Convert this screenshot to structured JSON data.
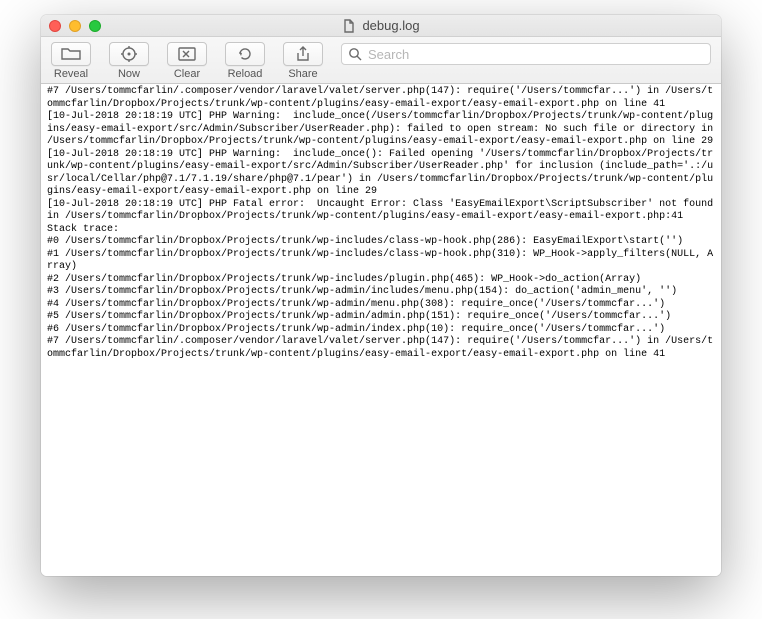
{
  "title": "debug.log",
  "toolbar": {
    "reveal": "Reveal",
    "now": "Now",
    "clear": "Clear",
    "reload": "Reload",
    "share": "Share"
  },
  "search": {
    "placeholder": "Search"
  },
  "log": "#7 /Users/tommcfarlin/.composer/vendor/laravel/valet/server.php(147): require('/Users/tommcfar...') in /Users/tommcfarlin/Dropbox/Projects/trunk/wp-content/plugins/easy-email-export/easy-email-export.php on line 41\n[10-Jul-2018 20:18:19 UTC] PHP Warning:  include_once(/Users/tommcfarlin/Dropbox/Projects/trunk/wp-content/plugins/easy-email-export/src/Admin/Subscriber/UserReader.php): failed to open stream: No such file or directory in /Users/tommcfarlin/Dropbox/Projects/trunk/wp-content/plugins/easy-email-export/easy-email-export.php on line 29\n[10-Jul-2018 20:18:19 UTC] PHP Warning:  include_once(): Failed opening '/Users/tommcfarlin/Dropbox/Projects/trunk/wp-content/plugins/easy-email-export/src/Admin/Subscriber/UserReader.php' for inclusion (include_path='.:/usr/local/Cellar/php@7.1/7.1.19/share/php@7.1/pear') in /Users/tommcfarlin/Dropbox/Projects/trunk/wp-content/plugins/easy-email-export/easy-email-export.php on line 29\n[10-Jul-2018 20:18:19 UTC] PHP Fatal error:  Uncaught Error: Class 'EasyEmailExport\\ScriptSubscriber' not found in /Users/tommcfarlin/Dropbox/Projects/trunk/wp-content/plugins/easy-email-export/easy-email-export.php:41\nStack trace:\n#0 /Users/tommcfarlin/Dropbox/Projects/trunk/wp-includes/class-wp-hook.php(286): EasyEmailExport\\start('')\n#1 /Users/tommcfarlin/Dropbox/Projects/trunk/wp-includes/class-wp-hook.php(310): WP_Hook->apply_filters(NULL, Array)\n#2 /Users/tommcfarlin/Dropbox/Projects/trunk/wp-includes/plugin.php(465): WP_Hook->do_action(Array)\n#3 /Users/tommcfarlin/Dropbox/Projects/trunk/wp-admin/includes/menu.php(154): do_action('admin_menu', '')\n#4 /Users/tommcfarlin/Dropbox/Projects/trunk/wp-admin/menu.php(308): require_once('/Users/tommcfar...')\n#5 /Users/tommcfarlin/Dropbox/Projects/trunk/wp-admin/admin.php(151): require_once('/Users/tommcfar...')\n#6 /Users/tommcfarlin/Dropbox/Projects/trunk/wp-admin/index.php(10): require_once('/Users/tommcfar...')\n#7 /Users/tommcfarlin/.composer/vendor/laravel/valet/server.php(147): require('/Users/tommcfar...') in /Users/tommcfarlin/Dropbox/Projects/trunk/wp-content/plugins/easy-email-export/easy-email-export.php on line 41"
}
